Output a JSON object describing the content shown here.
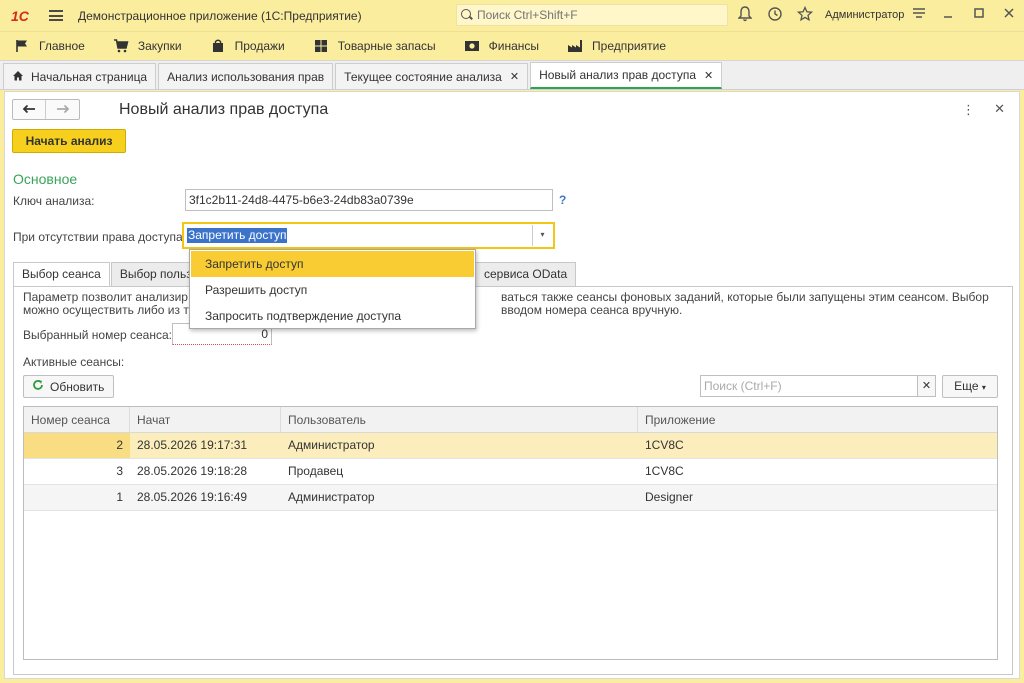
{
  "titlebar": {
    "logo": "1С",
    "app_title": "Демонстрационное приложение  (1С:Предприятие)",
    "search_placeholder": "Поиск Ctrl+Shift+F",
    "user": "Администратор"
  },
  "main_menu": [
    {
      "label": "Главное",
      "icon": "flag-icon"
    },
    {
      "label": "Закупки",
      "icon": "cart-icon"
    },
    {
      "label": "Продажи",
      "icon": "bag-icon"
    },
    {
      "label": "Товарные запасы",
      "icon": "grid-icon"
    },
    {
      "label": "Финансы",
      "icon": "money-icon"
    },
    {
      "label": "Предприятие",
      "icon": "factory-icon"
    }
  ],
  "window_tabs": [
    {
      "label": "Начальная страница"
    },
    {
      "label": "Анализ использования прав"
    },
    {
      "label": "Текущее состояние анализа"
    },
    {
      "label": "Новый анализ прав доступа"
    }
  ],
  "form": {
    "title": "Новый анализ прав доступа",
    "start_button": "Начать анализ",
    "section_title": "Основное",
    "key_label": "Ключ анализа:",
    "key_value": "3f1c2b11-24d8-4475-b6e3-24db83a0739e",
    "help": "?",
    "access_label": "При отсутствии права доступа:",
    "access_value": "Запретить доступ"
  },
  "inner_tabs": {
    "t1": "Выбор сеанса",
    "t2": "Выбор польз",
    "t3": "сервиса OData"
  },
  "session_panel": {
    "desc_l1a": "Параметр позволит анализир",
    "desc_l1b": "ваться также сеансы фоновых заданий, которые были запущены этим сеансом. Выбор",
    "desc_l2a": "можно осуществить либо из т",
    "desc_l2b": "вводом номера сеанса вручную.",
    "selected_label": "Выбранный номер сеанса:",
    "selected_value": "0",
    "active_label": "Активные сеансы:",
    "refresh": "Обновить",
    "search_placeholder": "Поиск (Ctrl+F)",
    "more": "Еще"
  },
  "grid": {
    "headers": [
      "Номер сеанса",
      "Начат",
      "Пользователь",
      "Приложение"
    ],
    "rows": [
      [
        "2",
        "28.05.2026 19:17:31",
        "Администратор",
        "1CV8C"
      ],
      [
        "3",
        "28.05.2026 19:18:28",
        "Продавец",
        "1CV8C"
      ],
      [
        "1",
        "28.05.2026 19:16:49",
        "Администратор",
        "Designer"
      ]
    ]
  },
  "dropdown": {
    "options": [
      "Запретить доступ",
      "Разрешить доступ",
      "Запросить подтверждение доступа"
    ]
  },
  "colors": {
    "titlebar_bg": "#fbed9e",
    "accent_yellow": "#f6d01d",
    "section_green": "#3aa35a",
    "selection_blue": "#3a73c9"
  }
}
